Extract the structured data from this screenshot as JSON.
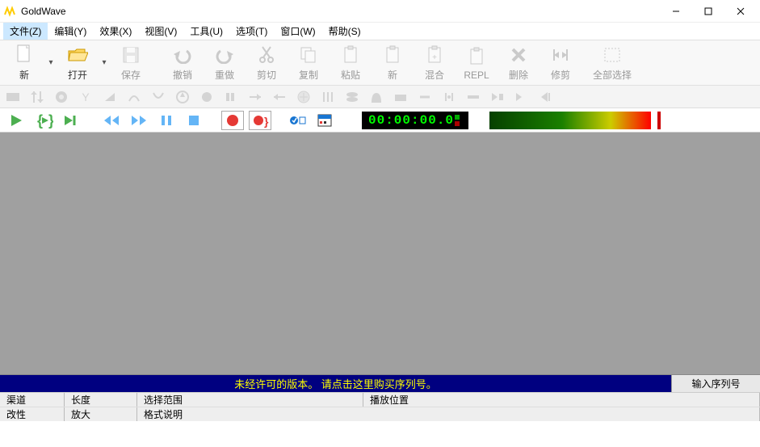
{
  "title": "GoldWave",
  "menu": [
    "文件(Z)",
    "编辑(Y)",
    "效果(X)",
    "视图(V)",
    "工具(U)",
    "选项(T)",
    "窗口(W)",
    "帮助(S)"
  ],
  "toolbar_main": [
    {
      "label": "新"
    },
    {
      "label": "打开"
    },
    {
      "label": "保存"
    },
    {
      "label": "撤销"
    },
    {
      "label": "重做"
    },
    {
      "label": "剪切"
    },
    {
      "label": "复制"
    },
    {
      "label": "粘贴"
    },
    {
      "label": "新"
    },
    {
      "label": "混合"
    },
    {
      "label": "REPL"
    },
    {
      "label": "删除"
    },
    {
      "label": "修剪"
    },
    {
      "label": "全部选择"
    }
  ],
  "timecode": "00:00:00.0",
  "license": {
    "message": "未经许可的版本。 请点击这里购买序列号。",
    "button": "输入序列号"
  },
  "status1": {
    "channel": "渠道",
    "length": "长度",
    "selection": "选择范围",
    "playpos": "播放位置"
  },
  "status2": {
    "modify": "改性",
    "zoom": "放大",
    "format": "格式说明"
  }
}
